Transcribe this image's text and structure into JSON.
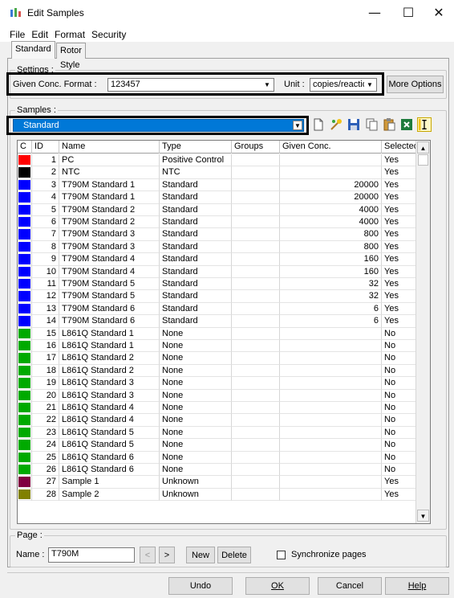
{
  "window": {
    "title": "Edit Samples",
    "minimize": "—",
    "maximize": "☐",
    "close": "✕"
  },
  "menu": [
    "File",
    "Edit",
    "Format",
    "Security"
  ],
  "tabs": [
    "Standard",
    "Rotor Style"
  ],
  "settings": {
    "group_label": "Settings :",
    "format_label": "Given Conc. Format :",
    "format_value": "123457",
    "unit_label": "Unit :",
    "unit_value": "copies/reaction",
    "more_options": "More Options"
  },
  "samples": {
    "group_label": "Samples :",
    "selected_type": "Standard",
    "columns": [
      "C",
      "ID",
      "Name",
      "Type",
      "Groups",
      "Given Conc.",
      "Selected"
    ],
    "rows": [
      {
        "color": "#ff0000",
        "id": "1",
        "name": "PC",
        "type": "Positive Control",
        "groups": "",
        "conc": "",
        "selected": "Yes"
      },
      {
        "color": "#000000",
        "id": "2",
        "name": "NTC",
        "type": "NTC",
        "groups": "",
        "conc": "",
        "selected": "Yes"
      },
      {
        "color": "#0000ff",
        "id": "3",
        "name": "T790M Standard 1",
        "type": "Standard",
        "groups": "",
        "conc": "20000",
        "selected": "Yes"
      },
      {
        "color": "#0000ff",
        "id": "4",
        "name": "T790M Standard 1",
        "type": "Standard",
        "groups": "",
        "conc": "20000",
        "selected": "Yes"
      },
      {
        "color": "#0000ff",
        "id": "5",
        "name": "T790M Standard 2",
        "type": "Standard",
        "groups": "",
        "conc": "4000",
        "selected": "Yes"
      },
      {
        "color": "#0000ff",
        "id": "6",
        "name": "T790M Standard 2",
        "type": "Standard",
        "groups": "",
        "conc": "4000",
        "selected": "Yes"
      },
      {
        "color": "#0000ff",
        "id": "7",
        "name": "T790M Standard 3",
        "type": "Standard",
        "groups": "",
        "conc": "800",
        "selected": "Yes"
      },
      {
        "color": "#0000ff",
        "id": "8",
        "name": "T790M Standard 3",
        "type": "Standard",
        "groups": "",
        "conc": "800",
        "selected": "Yes"
      },
      {
        "color": "#0000ff",
        "id": "9",
        "name": "T790M Standard 4",
        "type": "Standard",
        "groups": "",
        "conc": "160",
        "selected": "Yes"
      },
      {
        "color": "#0000ff",
        "id": "10",
        "name": "T790M Standard 4",
        "type": "Standard",
        "groups": "",
        "conc": "160",
        "selected": "Yes"
      },
      {
        "color": "#0000ff",
        "id": "11",
        "name": "T790M Standard 5",
        "type": "Standard",
        "groups": "",
        "conc": "32",
        "selected": "Yes"
      },
      {
        "color": "#0000ff",
        "id": "12",
        "name": "T790M Standard 5",
        "type": "Standard",
        "groups": "",
        "conc": "32",
        "selected": "Yes"
      },
      {
        "color": "#0000ff",
        "id": "13",
        "name": "T790M Standard 6",
        "type": "Standard",
        "groups": "",
        "conc": "6",
        "selected": "Yes"
      },
      {
        "color": "#0000ff",
        "id": "14",
        "name": "T790M Standard 6",
        "type": "Standard",
        "groups": "",
        "conc": "6",
        "selected": "Yes"
      },
      {
        "color": "#00aa00",
        "id": "15",
        "name": "L861Q Standard 1",
        "type": "None",
        "groups": "",
        "conc": "",
        "selected": "No"
      },
      {
        "color": "#00aa00",
        "id": "16",
        "name": "L861Q Standard 1",
        "type": "None",
        "groups": "",
        "conc": "",
        "selected": "No"
      },
      {
        "color": "#00aa00",
        "id": "17",
        "name": "L861Q Standard 2",
        "type": "None",
        "groups": "",
        "conc": "",
        "selected": "No"
      },
      {
        "color": "#00aa00",
        "id": "18",
        "name": "L861Q Standard 2",
        "type": "None",
        "groups": "",
        "conc": "",
        "selected": "No"
      },
      {
        "color": "#00aa00",
        "id": "19",
        "name": "L861Q Standard 3",
        "type": "None",
        "groups": "",
        "conc": "",
        "selected": "No"
      },
      {
        "color": "#00aa00",
        "id": "20",
        "name": "L861Q Standard 3",
        "type": "None",
        "groups": "",
        "conc": "",
        "selected": "No"
      },
      {
        "color": "#00aa00",
        "id": "21",
        "name": "L861Q Standard 4",
        "type": "None",
        "groups": "",
        "conc": "",
        "selected": "No"
      },
      {
        "color": "#00aa00",
        "id": "22",
        "name": "L861Q Standard 4",
        "type": "None",
        "groups": "",
        "conc": "",
        "selected": "No"
      },
      {
        "color": "#00aa00",
        "id": "23",
        "name": "L861Q Standard 5",
        "type": "None",
        "groups": "",
        "conc": "",
        "selected": "No"
      },
      {
        "color": "#00aa00",
        "id": "24",
        "name": "L861Q Standard 5",
        "type": "None",
        "groups": "",
        "conc": "",
        "selected": "No"
      },
      {
        "color": "#00aa00",
        "id": "25",
        "name": "L861Q Standard 6",
        "type": "None",
        "groups": "",
        "conc": "",
        "selected": "No"
      },
      {
        "color": "#00aa00",
        "id": "26",
        "name": "L861Q Standard 6",
        "type": "None",
        "groups": "",
        "conc": "",
        "selected": "No"
      },
      {
        "color": "#800040",
        "id": "27",
        "name": "Sample 1",
        "type": "Unknown",
        "groups": "",
        "conc": "",
        "selected": "Yes"
      },
      {
        "color": "#808000",
        "id": "28",
        "name": "Sample 2",
        "type": "Unknown",
        "groups": "",
        "conc": "",
        "selected": "Yes"
      }
    ]
  },
  "page": {
    "group_label": "Page :",
    "name_label": "Name :",
    "name_value": "T790M",
    "prev": "<",
    "next": ">",
    "new": "New",
    "delete": "Delete",
    "sync_label": "Synchronize pages"
  },
  "footer": {
    "undo": "Undo",
    "ok": "OK",
    "cancel": "Cancel",
    "help": "Help"
  }
}
